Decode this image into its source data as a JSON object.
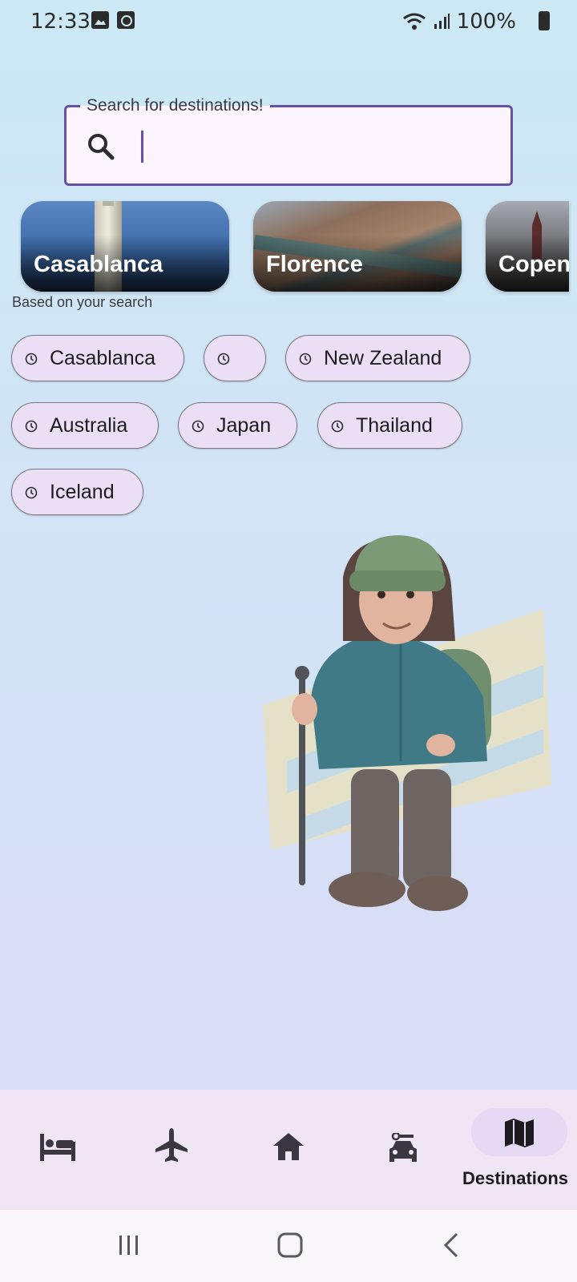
{
  "status_bar": {
    "time": "12:33",
    "battery": "100%"
  },
  "search": {
    "label": "Search for destinations!",
    "value": "",
    "placeholder": ""
  },
  "destinations": [
    {
      "name": "Casablanca"
    },
    {
      "name": "Florence"
    },
    {
      "name": "Copen"
    }
  ],
  "suggestions": {
    "caption": "Based on your search",
    "chips": [
      "Casablanca",
      "",
      "New Zealand",
      "Australia",
      "Japan",
      "Thailand",
      "Iceland"
    ]
  },
  "bottom_nav": {
    "items": [
      {
        "icon": "bed-icon",
        "label": ""
      },
      {
        "icon": "airplane-icon",
        "label": ""
      },
      {
        "icon": "home-icon",
        "label": ""
      },
      {
        "icon": "car-icon",
        "label": ""
      },
      {
        "icon": "map-icon",
        "label": "Destinations"
      }
    ],
    "active": "Destinations"
  },
  "colors": {
    "accent": "#6750a4",
    "chip_bg": "#ebdff6",
    "nav_bg": "#efe5f5"
  }
}
